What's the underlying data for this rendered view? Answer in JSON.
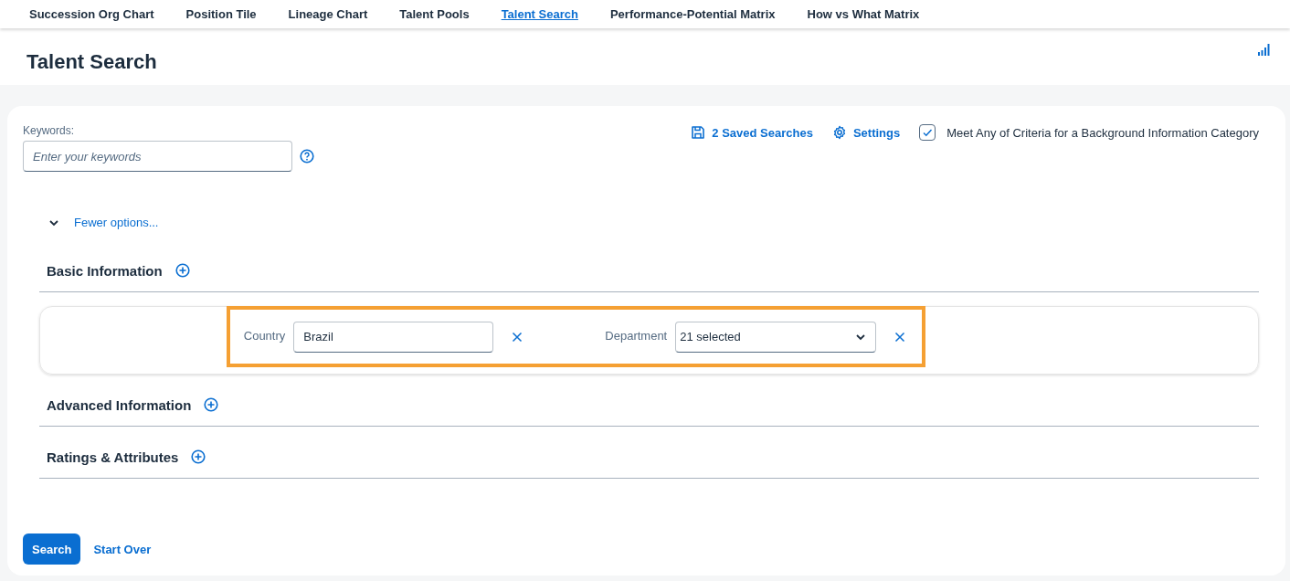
{
  "tabs": [
    {
      "label": "Succession Org Chart",
      "selected": false
    },
    {
      "label": "Position Tile",
      "selected": false
    },
    {
      "label": "Lineage Chart",
      "selected": false
    },
    {
      "label": "Talent Pools",
      "selected": false
    },
    {
      "label": "Talent Search",
      "selected": true
    },
    {
      "label": "Performance-Potential Matrix",
      "selected": false
    },
    {
      "label": "How vs What Matrix",
      "selected": false
    }
  ],
  "page_title": "Talent Search",
  "keywords": {
    "label": "Keywords:",
    "placeholder": "Enter your keywords"
  },
  "saved_searches": "2 Saved Searches",
  "settings": "Settings",
  "criteria_option": {
    "label": "Meet Any of Criteria for a Background Information Category",
    "checked": true
  },
  "options_toggle": {
    "label": "Fewer options...",
    "expanded": true
  },
  "sections": [
    {
      "title": "Basic Information",
      "filters_highlighted": true,
      "filters": [
        {
          "kind": "text",
          "label": "Country",
          "value": "Brazil"
        },
        {
          "kind": "dropdown",
          "label": "Department",
          "value": "21 selected"
        }
      ]
    },
    {
      "title": "Advanced Information"
    },
    {
      "title": "Ratings & Attributes"
    }
  ],
  "buttons": {
    "search": "Search",
    "start_over": "Start Over"
  }
}
